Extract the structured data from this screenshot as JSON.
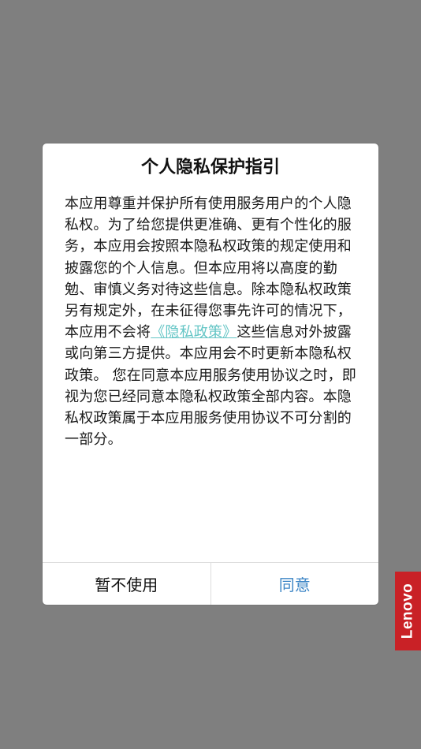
{
  "dialog": {
    "title": "个人隐私保护指引",
    "body_part1": "本应用尊重并保护所有使用服务用户的个人隐私权。为了给您提供更准确、更有个性化的服务，本应用会按照本隐私权政策的规定使用和披露您的个人信息。但本应用将以高度的勤勉、审慎义务对待这些信息。除本隐私权政策另有规定外，在未征得您事先许可的情况下，本应用不会将",
    "policy_link": "《隐私政策》",
    "body_part2": "这些信息对外披露或向第三方提供。本应用会不时更新本隐私权政策。 您在同意本应用服务使用协议之时，即视为您已经同意本隐私权政策全部内容。本隐私权政策属于本应用服务使用协议不可分割的一部分。",
    "cancel_label": "暂不使用",
    "agree_label": "同意"
  },
  "brand": {
    "label": "Lenovo"
  },
  "colors": {
    "overlay": "#7f7f7f",
    "link": "#63c5c5",
    "agree": "#3d86c6",
    "brand_red": "#c92126"
  }
}
